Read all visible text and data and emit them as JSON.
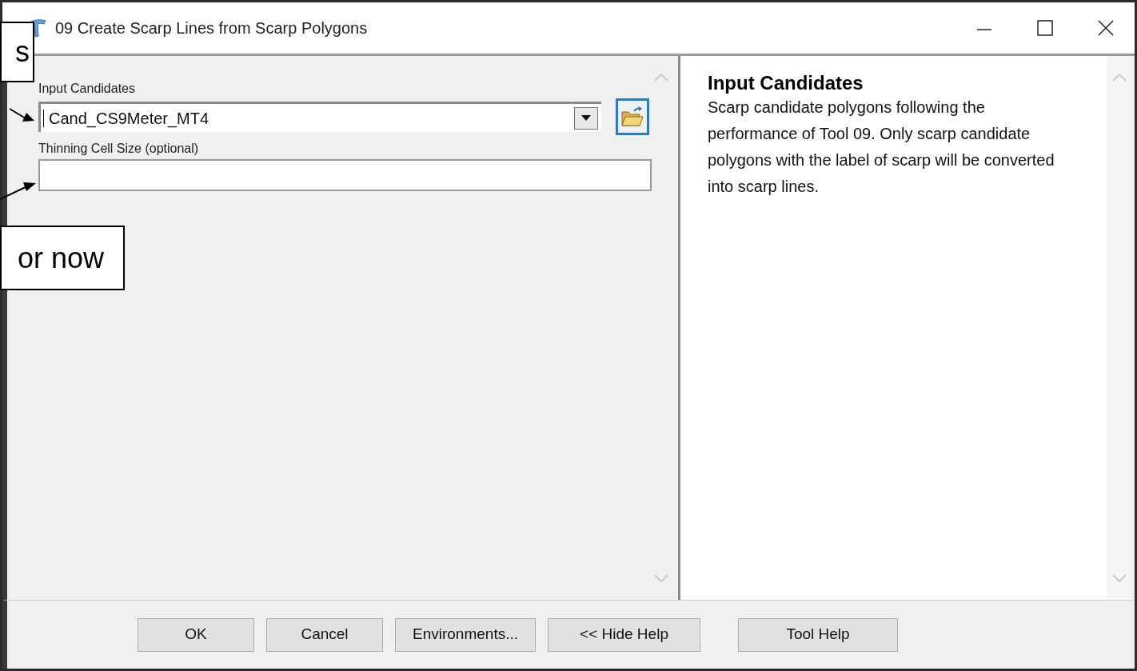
{
  "window": {
    "title": "09 Create Scarp Lines from Scarp Polygons"
  },
  "parameters": [
    {
      "kind": "combo",
      "label": "Input Candidates",
      "value": "Cand_CS9Meter_MT4"
    },
    {
      "kind": "text",
      "label": "Thinning Cell Size (optional)"
    }
  ],
  "help": {
    "heading": "Input Candidates",
    "body": "Scarp candidate polygons following the performance of Tool 09. Only scarp candidate polygons with the label of scarp will be converted into scarp lines."
  },
  "buttons": [
    "OK",
    "Cancel",
    "Environments...",
    "<< Hide Help",
    "Tool Help"
  ],
  "callouts": [
    "s",
    "or now"
  ]
}
